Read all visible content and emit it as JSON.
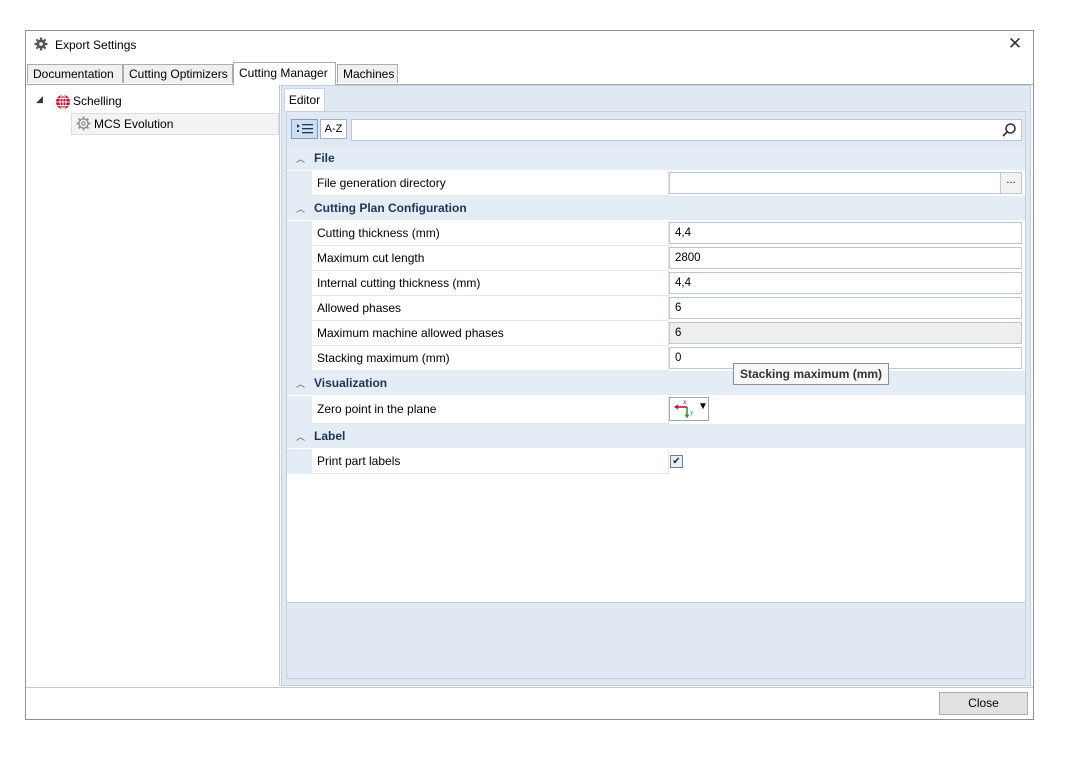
{
  "window": {
    "title": "Export Settings",
    "close_glyph": "✕"
  },
  "tabs": [
    {
      "label": "Documentation"
    },
    {
      "label": "Cutting Optimizers"
    },
    {
      "label": "Cutting Manager"
    },
    {
      "label": "Machines"
    }
  ],
  "tree": {
    "root": {
      "label": "Schelling",
      "icon": "globe-icon"
    },
    "child": {
      "label": "MCS Evolution",
      "icon": "gear-icon"
    }
  },
  "editor": {
    "tab_label": "Editor",
    "toolbar": {
      "categorized_label": "",
      "alpha_label": "A-Z",
      "search_placeholder": ""
    }
  },
  "categories": [
    {
      "label": "File",
      "props": [
        {
          "name": "File generation directory",
          "value": "",
          "button": "..."
        }
      ]
    },
    {
      "label": "Cutting Plan Configuration",
      "props": [
        {
          "name": "Cutting thickness (mm)",
          "value": "4,4"
        },
        {
          "name": "Maximum cut length",
          "value": "2800"
        },
        {
          "name": "Internal cutting thickness (mm)",
          "value": "4,4"
        },
        {
          "name": "Allowed phases",
          "value": "6"
        },
        {
          "name": "Maximum machine allowed phases",
          "value": "6"
        },
        {
          "name": "Stacking maximum (mm)",
          "value": "0"
        }
      ]
    },
    {
      "label": "Visualization",
      "props": [
        {
          "name": "Zero point in the plane"
        }
      ]
    },
    {
      "label": "Label",
      "props": [
        {
          "name": "Print part labels",
          "checked": "✔"
        }
      ]
    }
  ],
  "tooltip": "Stacking maximum (mm)",
  "footer": {
    "close_label": "Close"
  },
  "colors": {
    "category_bg": "#e4ecf6",
    "panel_bg": "#dfe8f3",
    "category_text": "#1e3555"
  }
}
